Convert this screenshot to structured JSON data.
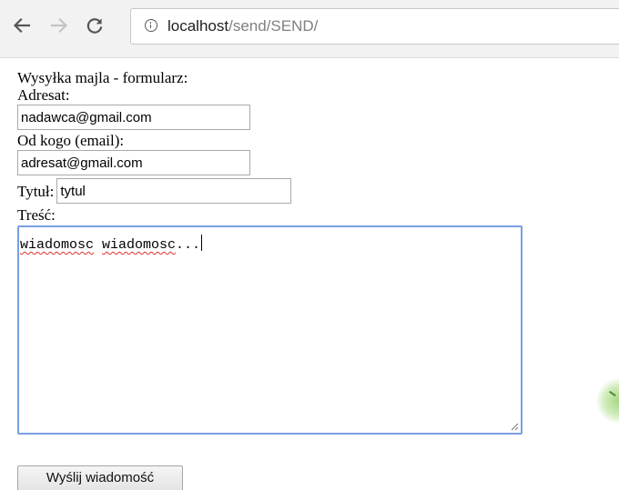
{
  "browser": {
    "back_icon": "arrow-left-icon",
    "forward_icon": "arrow-right-icon",
    "reload_icon": "reload-icon",
    "info_icon": "info-icon",
    "url_host": "localhost",
    "url_path": "/send/SEND/"
  },
  "form": {
    "heading": "Wysyłka majla - formularz:",
    "recipient_label": "Adresat:",
    "recipient_value": "nadawca@gmail.com",
    "sender_label": "Od kogo (email):",
    "sender_value": "adresat@gmail.com",
    "title_label": "Tytuł:",
    "title_value": "tytul",
    "body_label": "Treść:",
    "body_word_1": "wiadomosc",
    "body_word_2": "wiadomosc",
    "body_tail": "...",
    "submit_label": "Wyślij wiadomość"
  },
  "colors": {
    "textarea_focus_border": "#79a0e0",
    "spellcheck_underline": "#e03030"
  }
}
